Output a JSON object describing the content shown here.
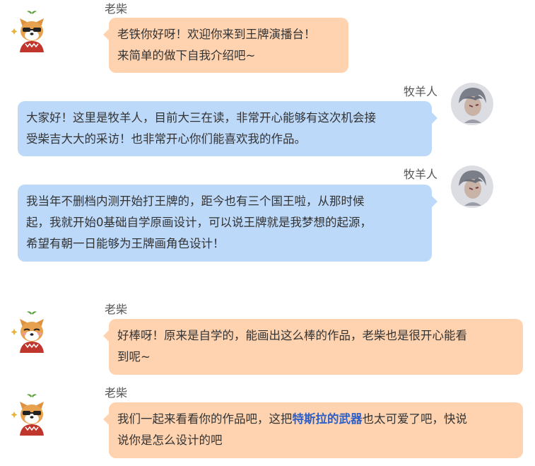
{
  "messages": [
    {
      "sender": "老柴",
      "side": "left",
      "lines": [
        "老铁你好呀！欢迎你来到王牌演播台！",
        "来简单的做下自我介绍吧~"
      ]
    },
    {
      "sender": "牧羊人",
      "side": "right",
      "lines": [
        "大家好！这里是牧羊人，目前大三在读，非常开心能够有这次机会接",
        "受柴吉大大的采访！也非常开心你们能喜欢我的作品。"
      ]
    },
    {
      "sender": "牧羊人",
      "side": "right",
      "lines": [
        "我当年不删档内测开始打王牌的，距今也有三个国王啦，从那时候",
        "起，我就开始0基础自学原画设计，可以说王牌就是我梦想的起源，",
        "希望有朝一日能够为王牌画角色设计！"
      ]
    },
    {
      "sender": "老柴",
      "side": "left",
      "lines": [
        "好棒呀！原来是自学的，能画出这么棒的作品，老柴也是很开心能看",
        "到呢~"
      ]
    },
    {
      "sender": "老柴",
      "side": "left",
      "line1_before": "我们一起来看看你的作品吧，这把",
      "line1_highlight": "特斯拉的武器",
      "line1_after": "也太可爱了吧，快说",
      "line2": "说你是怎么设计的吧"
    }
  ],
  "colors": {
    "left_bubble": "#ffd3b0",
    "right_bubble": "#bcd9fa",
    "highlight": "#2d5fc7"
  },
  "icons": {
    "left_avatar": "shiba-dog-sunglasses-avatar",
    "right_avatar": "grey-haired-boy-avatar"
  }
}
